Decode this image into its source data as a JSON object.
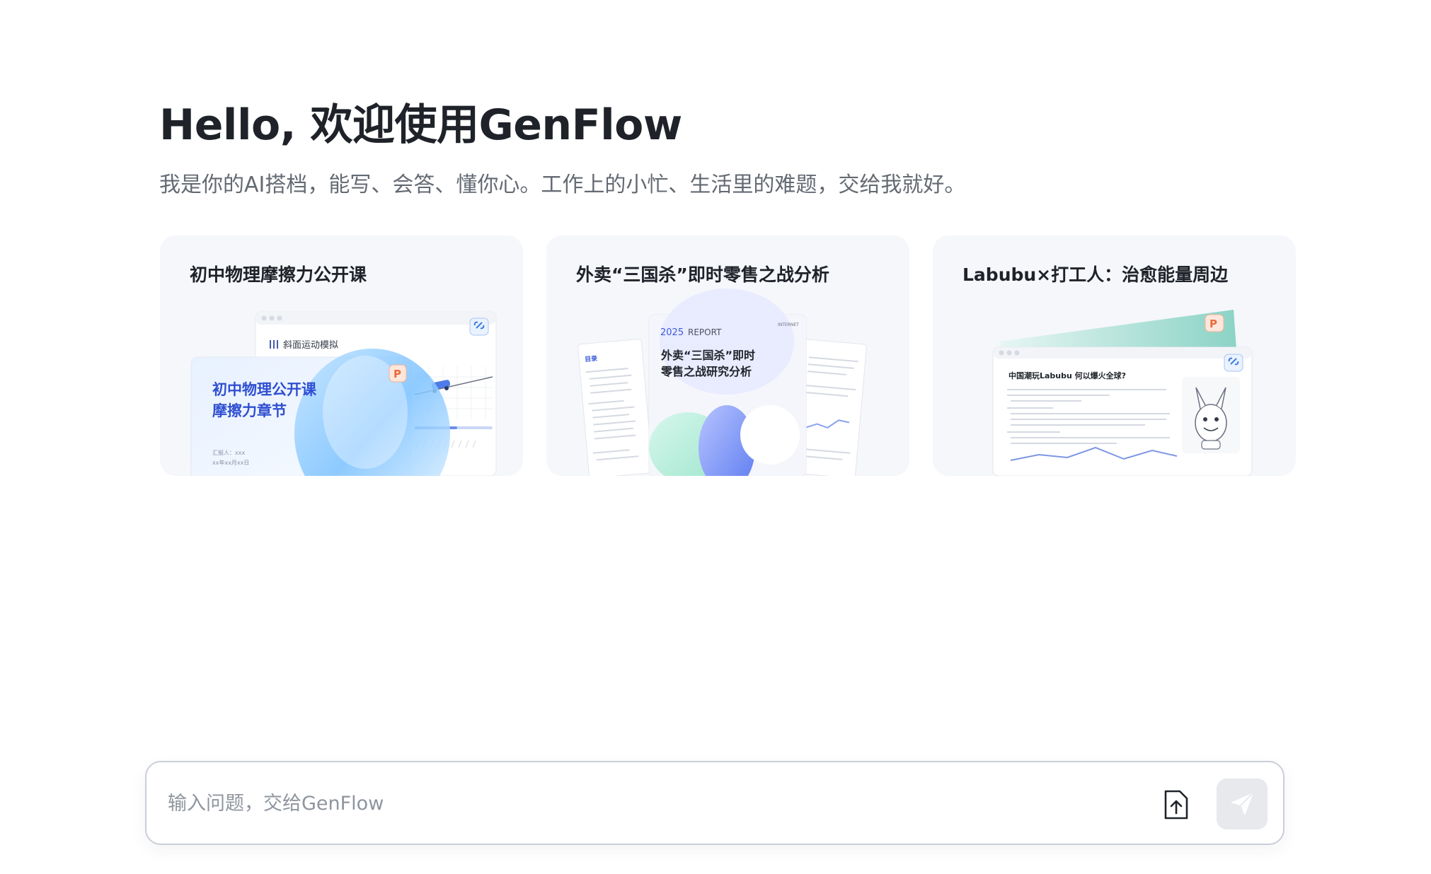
{
  "hero": {
    "title": "Hello, 欢迎使用GenFlow",
    "subtitle": "我是你的AI搭档，能写、会答、懂你心。工作上的小忙、生活里的难题，交给我就好。"
  },
  "cards": [
    {
      "title": "初中物理摩擦力公开课",
      "preview": {
        "window_label": "斜面运动模拟",
        "slide_title_line1": "初中物理公开课",
        "slide_title_line2": "摩擦力章节",
        "slide_footer_1": "汇报人：xxx",
        "slide_footer_2": "xx年xx月xx日",
        "badge": "P"
      }
    },
    {
      "title": "外卖“三国杀”即时零售之战分析",
      "preview": {
        "year": "2025",
        "report": "REPORT",
        "corner_text": "INTERNET",
        "doc_title_line1": "外卖“三国杀”即时",
        "doc_title_line2": "零售之战研究分析",
        "toc_label": "目录"
      }
    },
    {
      "title": "Labubu×打工人：治愈能量周边",
      "preview": {
        "doc_title": "中国潮玩Labubu  何以爆火全球?",
        "badge": "P"
      }
    }
  ],
  "composer": {
    "placeholder": "输入问题，交给GenFlow",
    "upload_icon": "file-upload-icon",
    "send_icon": "paper-plane-icon"
  },
  "colors": {
    "title": "#1f2329",
    "subtitle": "#646a73",
    "card_bg": "#f5f7fb",
    "accent_blue": "#3b5bdb",
    "badge_orange": "#f08a5d",
    "send_bg": "#e7e9ed"
  }
}
